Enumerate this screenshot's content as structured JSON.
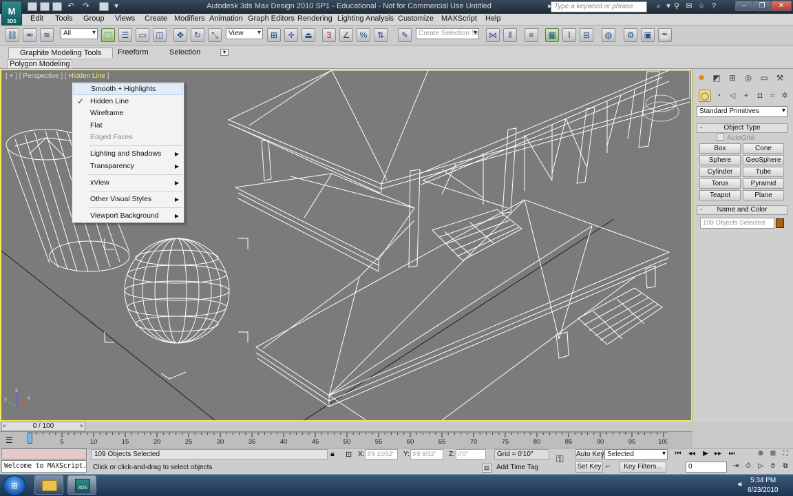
{
  "window": {
    "title": "Autodesk 3ds Max Design 2010 SP1 - Educational - Not for Commercial Use    Untitled",
    "logo_text": "3DS",
    "search_placeholder": "Type a keyword or phrase"
  },
  "menu": [
    "Edit",
    "Tools",
    "Group",
    "Views",
    "Create",
    "Modifiers",
    "Animation",
    "Graph Editors",
    "Rendering",
    "Lighting Analysis",
    "Customize",
    "MAXScript",
    "Help"
  ],
  "toolbar": {
    "filter_value": "All",
    "ref_coord_value": "View",
    "selection_set_placeholder": "Create Selection Se",
    "snap_label": "3"
  },
  "ribbon": {
    "tabs": [
      "Graphite Modeling Tools",
      "Freeform",
      "Selection"
    ],
    "panel_tab": "Polygon Modeling"
  },
  "viewport": {
    "label_prefix": "[ + ] [ Perspective ] [",
    "label_mode": " Hidden Line ",
    "label_suffix": "]",
    "axis_x": "x",
    "axis_y": "y",
    "axis_z": "z"
  },
  "context_menu": {
    "items": [
      {
        "label": "Smooth + Highlights"
      },
      {
        "label": "Hidden Line"
      },
      {
        "label": "Wireframe"
      },
      {
        "label": "Flat"
      },
      {
        "label": "Edged Faces"
      },
      {
        "label": "Lighting and Shadows"
      },
      {
        "label": "Transparency"
      },
      {
        "label": "xView"
      },
      {
        "label": "Other Visual Styles"
      },
      {
        "label": "Viewport Background"
      }
    ]
  },
  "command_panel": {
    "category": "Standard Primitives",
    "object_type_title": "Object Type",
    "autogrid_label": "AutoGrid",
    "primitives": [
      "Box",
      "Cone",
      "Sphere",
      "GeoSphere",
      "Cylinder",
      "Tube",
      "Torus",
      "Pyramid",
      "Teapot",
      "Plane"
    ],
    "name_color_title": "Name and Color",
    "name_placeholder": "109 Objects Selected",
    "object_color": "#b85b08"
  },
  "timeline": {
    "position": "0 / 100",
    "ticks": [
      "0",
      "5",
      "10",
      "15",
      "20",
      "25",
      "30",
      "35",
      "40",
      "45",
      "50",
      "55",
      "60",
      "65",
      "70",
      "75",
      "80",
      "85",
      "90",
      "95",
      "100"
    ]
  },
  "status": {
    "maxscript_output": "Welcome to MAXScript.",
    "selection_count": "109 Objects Selected",
    "prompt": "Click or click-and-drag to select objects",
    "x_label": "X:",
    "x_value": "3'9 10/32\"",
    "y_label": "Y:",
    "y_value": "9'8 8/32\"",
    "z_label": "Z:",
    "z_value": "0'0\"",
    "grid": "Grid = 0'10\"",
    "add_time_tag": "Add Time Tag",
    "auto_key": "Auto Key",
    "set_key": "Set Key",
    "key_mode": "Selected",
    "key_filters": "Key Filters...",
    "frame": "0"
  },
  "taskbar": {
    "time": "5:34 PM",
    "date": "6/23/2010",
    "max_btn_text": "3DS"
  },
  "colors": {
    "viewport_bg": "#7b7b7b",
    "active_border": "#f5e95a",
    "wire": "#ffffff"
  }
}
